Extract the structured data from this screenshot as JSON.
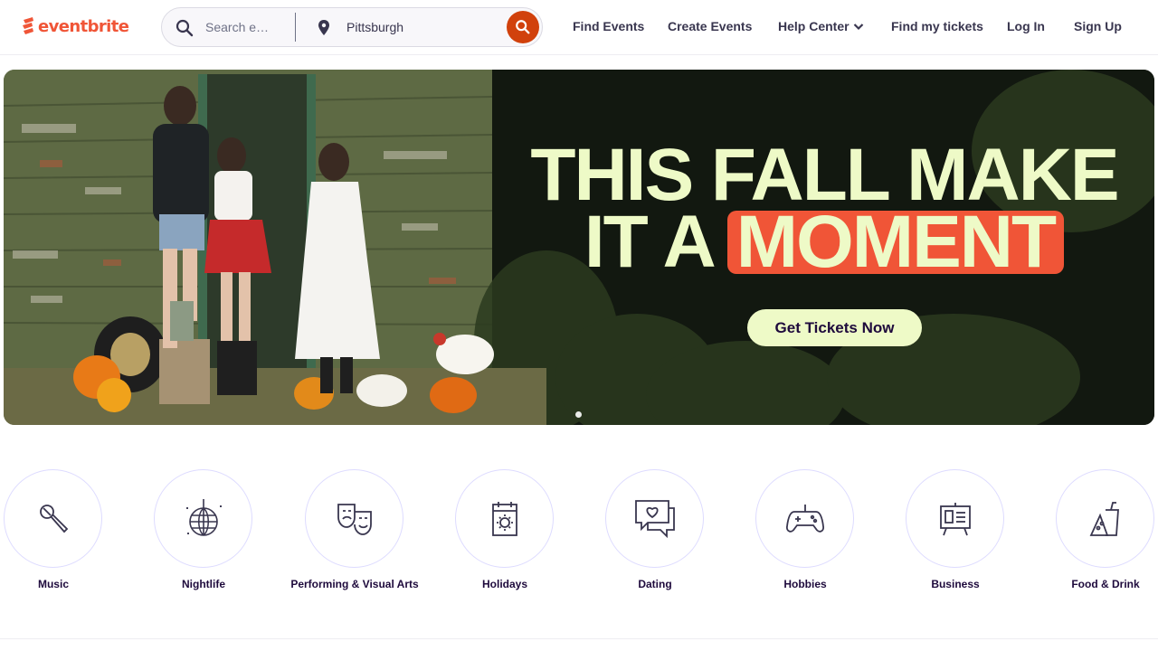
{
  "header": {
    "logo_text": "eventbrite",
    "search": {
      "placeholder": "Search events",
      "location": "Pittsburgh"
    },
    "nav": {
      "find_events": "Find Events",
      "create_events": "Create Events",
      "help_center": "Help Center",
      "find_tickets": "Find my tickets",
      "log_in": "Log In",
      "sign_up": "Sign Up"
    }
  },
  "banner": {
    "headline_line1": "THIS FALL MAKE",
    "headline_line2_a": "IT A",
    "headline_line2_b": "MOMENT",
    "cta": "Get Tickets Now"
  },
  "categories": [
    {
      "label": "Music",
      "icon": "microphone-icon"
    },
    {
      "label": "Nightlife",
      "icon": "disco-ball-icon"
    },
    {
      "label": "Performing & Visual Arts",
      "icon": "theater-masks-icon"
    },
    {
      "label": "Holidays",
      "icon": "calendar-sun-icon"
    },
    {
      "label": "Dating",
      "icon": "chat-heart-icon"
    },
    {
      "label": "Hobbies",
      "icon": "gamepad-icon"
    },
    {
      "label": "Business",
      "icon": "presentation-board-icon"
    },
    {
      "label": "Food & Drink",
      "icon": "food-drink-icon"
    }
  ],
  "colors": {
    "brand": "#f05537",
    "search_button": "#d1410c",
    "banner_text": "#eefac7"
  }
}
